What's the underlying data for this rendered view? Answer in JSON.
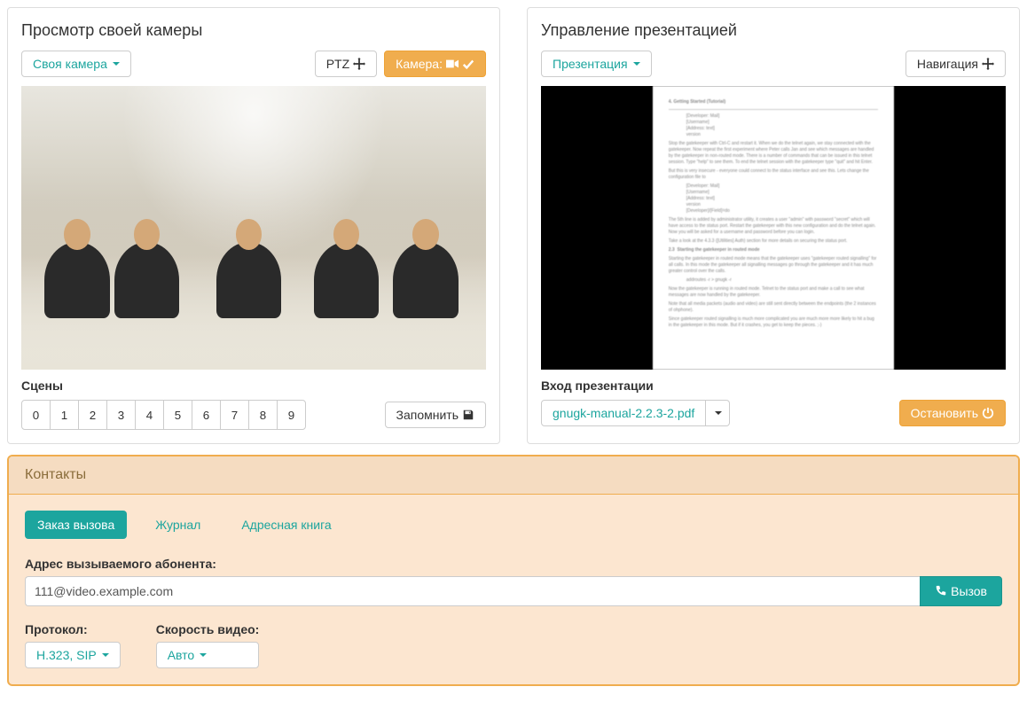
{
  "camera_panel": {
    "title": "Просмотр своей камеры",
    "own_camera_btn": "Своя камера",
    "ptz_btn": "PTZ",
    "camera_btn": "Камера:",
    "scenes_label": "Сцены",
    "scenes": [
      "0",
      "1",
      "2",
      "3",
      "4",
      "5",
      "6",
      "7",
      "8",
      "9"
    ],
    "remember_btn": "Запомнить"
  },
  "pres_panel": {
    "title": "Управление презентацией",
    "presentation_btn": "Презентация",
    "navigation_btn": "Навигация",
    "input_label": "Вход презентации",
    "file_name": "gnugk-manual-2.2.3-2.pdf",
    "stop_btn": "Остановить"
  },
  "contacts": {
    "title": "Контакты",
    "tabs": {
      "order": "Заказ вызова",
      "journal": "Журнал",
      "address_book": "Адресная книга"
    },
    "address_label": "Адрес вызываемого абонента:",
    "address_value": "111@video.example.com",
    "call_btn": "Вызов",
    "protocol_label": "Протокол:",
    "protocol_value": "H.323, SIP",
    "speed_label": "Скорость видео:",
    "speed_value": "Авто"
  }
}
